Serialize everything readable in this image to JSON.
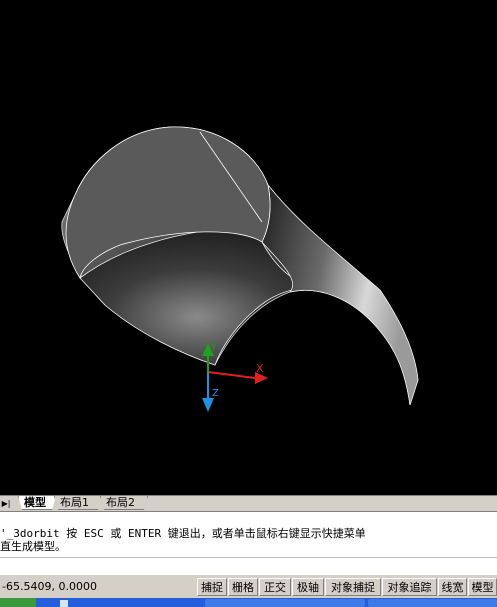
{
  "viewport": {
    "axes": {
      "x_label": "X",
      "y_label": "Y",
      "z_label": "Z"
    }
  },
  "tabs": {
    "nav_icon": "tab-scroll-arrows-icon",
    "items": [
      {
        "label": "模型",
        "active": true
      },
      {
        "label": "布局1",
        "active": false
      },
      {
        "label": "布局2",
        "active": false
      }
    ]
  },
  "command_window": {
    "line1": "'_3dorbit 按 ESC 或 ENTER 键退出，或者单击鼠标右键显示快捷菜单",
    "line2": "直生成模型。",
    "input_value": ""
  },
  "status_bar": {
    "coordinates": "-65.5409, 0.0000",
    "buttons": [
      "捕捉",
      "栅格",
      "正交",
      "极轴",
      "对象捕捉",
      "对象追踪",
      "线宽",
      "模型"
    ]
  },
  "colors": {
    "viewport_bg": "#000000",
    "x_axis": "#e02020",
    "y_axis": "#20a020",
    "z_axis": "#2090e0",
    "surface_edge": "#ffffff"
  }
}
